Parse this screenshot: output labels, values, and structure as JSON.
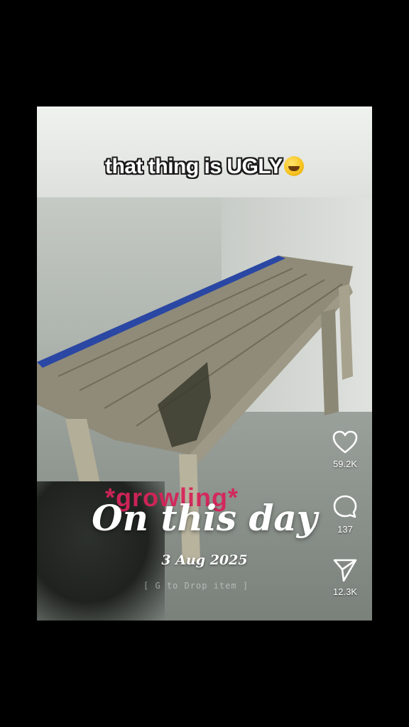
{
  "video": {
    "caption": "that thing is UGLY",
    "caption_emoji": "rolling-on-floor-laughing-emoji",
    "game_label": "*growling*",
    "hint": "[ G to Drop item ]"
  },
  "overlay": {
    "title": "On this day",
    "date": "3 Aug 2025"
  },
  "actions": {
    "like": {
      "icon": "heart-icon",
      "count": "59.2K"
    },
    "comment": {
      "icon": "comment-bubble-icon",
      "count": "137"
    },
    "share": {
      "icon": "paper-plane-icon",
      "count": "12.3K"
    }
  },
  "colors": {
    "background": "#000000",
    "game_label": "#d6245a",
    "text": "#ffffff"
  }
}
